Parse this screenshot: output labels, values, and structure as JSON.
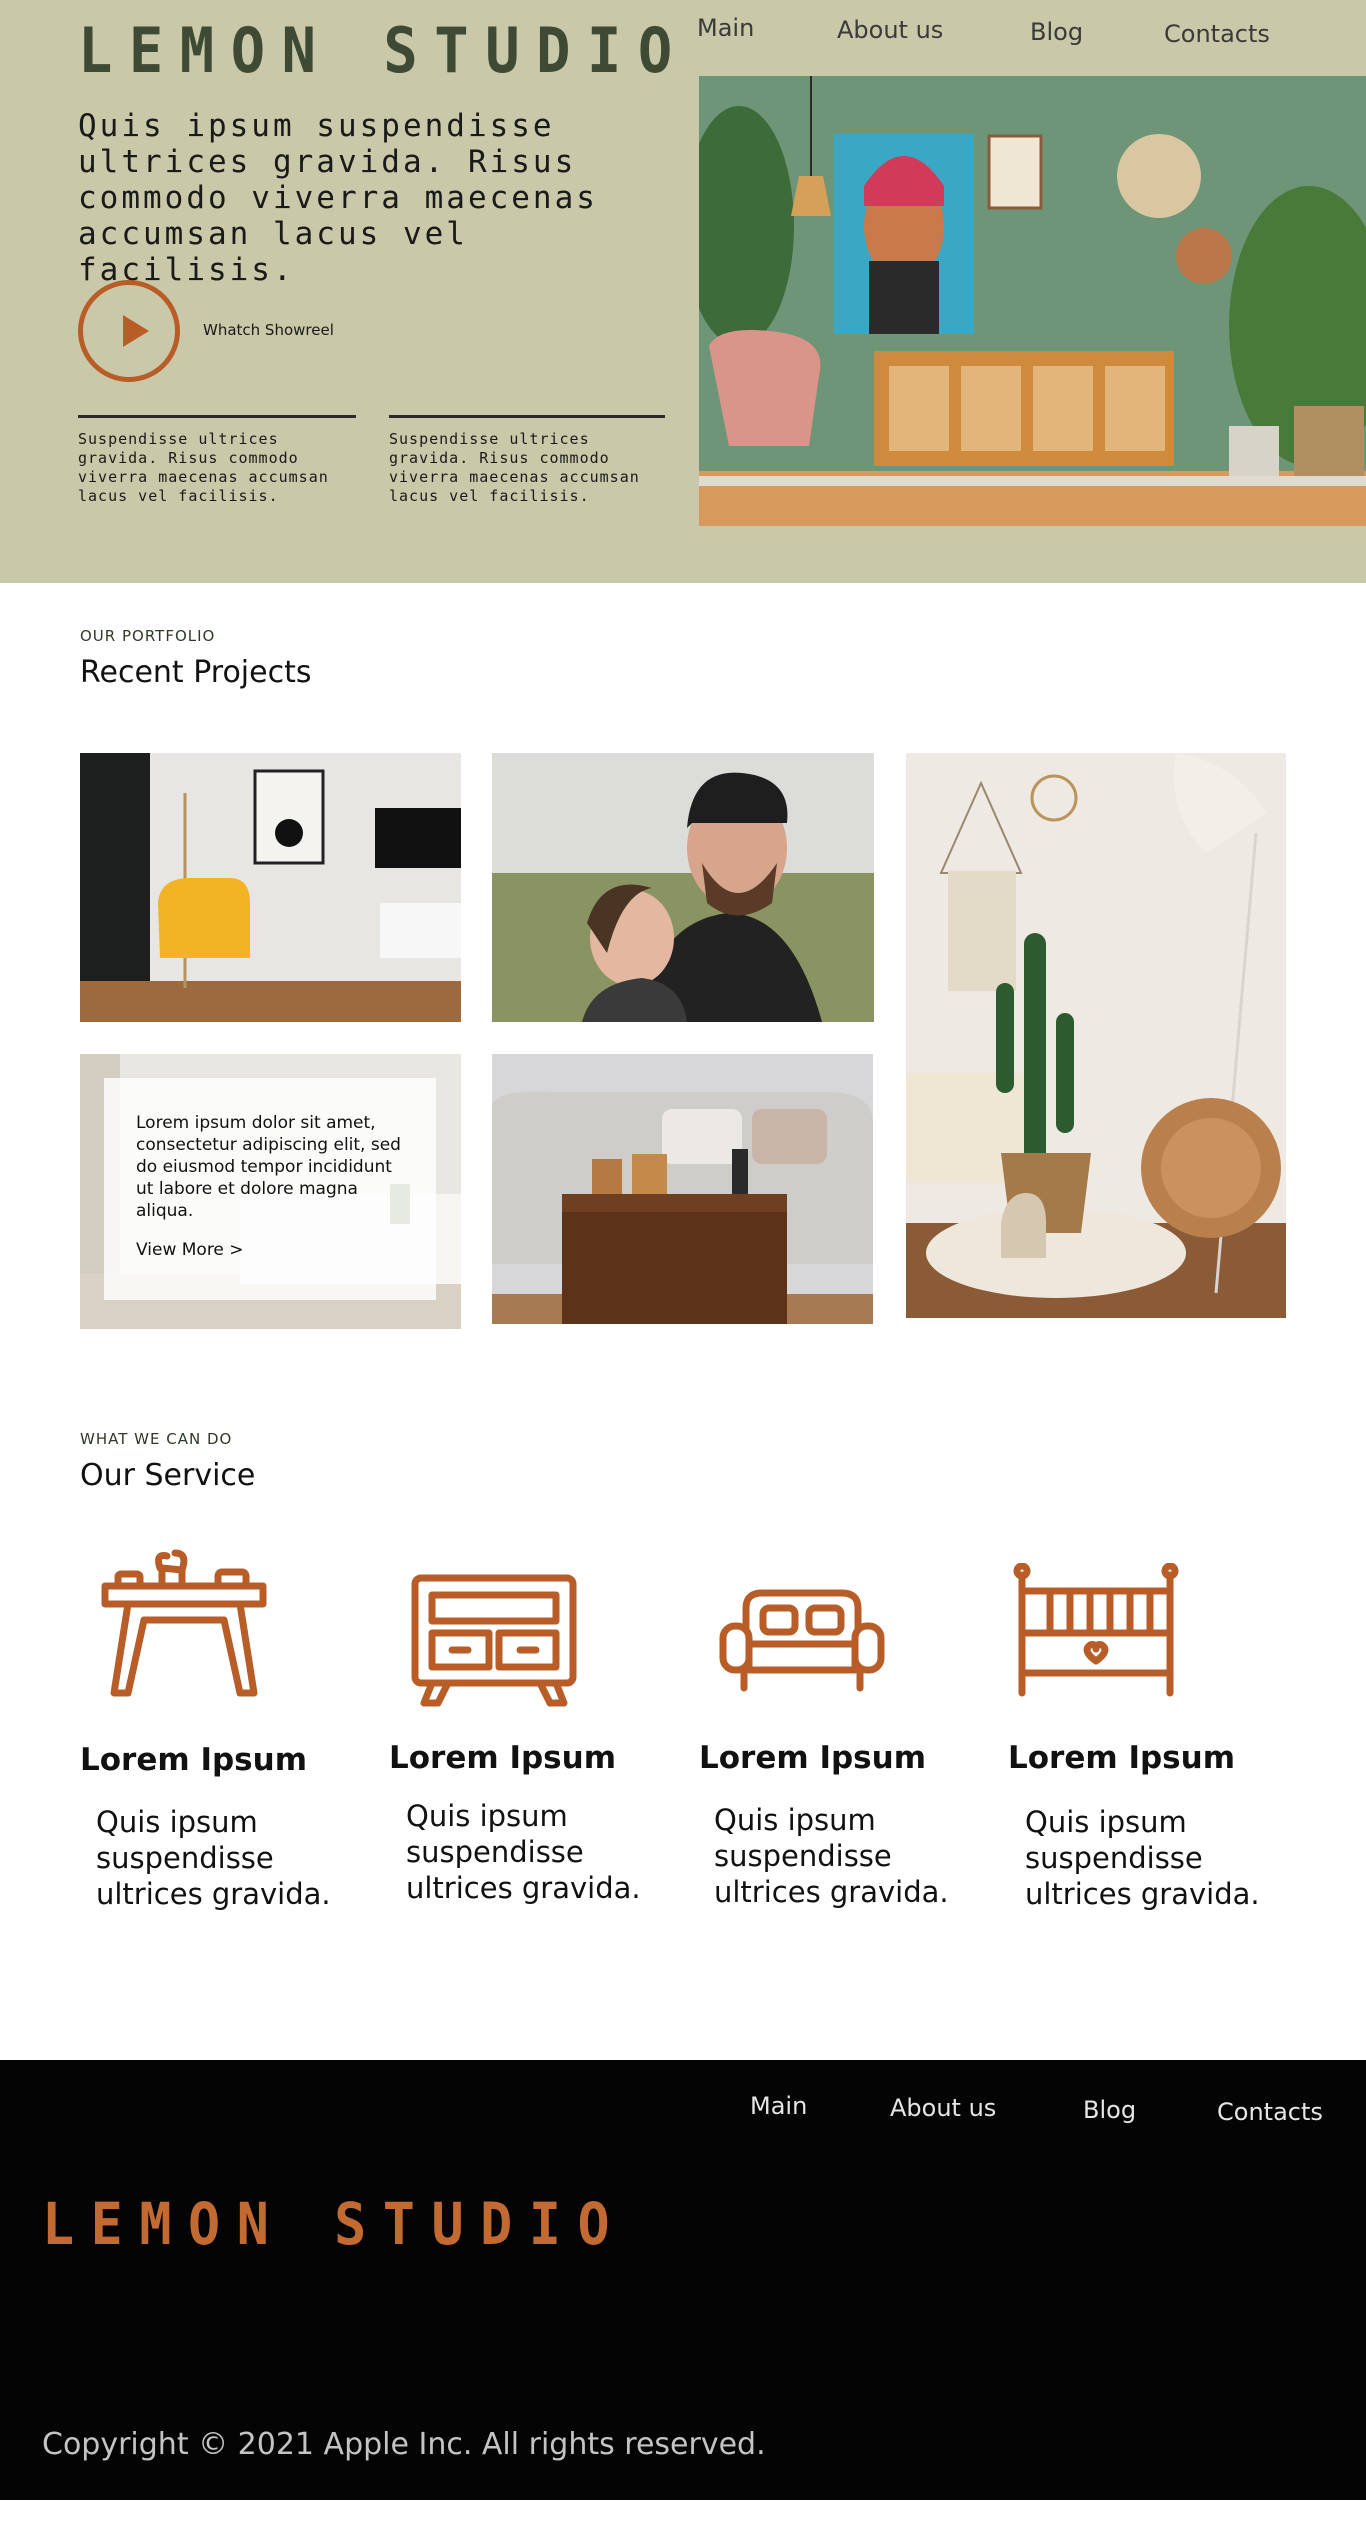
{
  "brand": {
    "name": "LEMON STUDIO",
    "accent": "#b85d27",
    "hero_bg": "#c9c8a8",
    "logo_color": "#3e4a33"
  },
  "nav": {
    "items": [
      "Main",
      "About us",
      "Blog",
      "Contacts"
    ]
  },
  "hero": {
    "headline": "Quis ipsum suspendisse ultrices gravida. Risus commodo viverra maecenas accumsan lacus vel facilisis.",
    "showreel_label": "Whatch Showreel",
    "features": [
      "Suspendisse ultrices gravida. Risus commodo viverra maecenas accumsan lacus vel facilisis.",
      "Suspendisse ultrices gravida. Risus commodo viverra maecenas accumsan lacus vel facilisis."
    ],
    "image": "living-room-photo"
  },
  "portfolio": {
    "eyebrow": "OUR PORTFOLIO",
    "title": "Recent Projects",
    "projects": [
      {
        "name": "yellow-armchair-room-photo"
      },
      {
        "name": "father-daughter-photo"
      },
      {
        "name": "boho-cactus-room-photo"
      },
      {
        "name": "white-living-room-photo"
      },
      {
        "name": "sofa-coffee-table-photo"
      }
    ],
    "overlay_text": "Lorem ipsum dolor sit amet, consectetur adipiscing elit, sed do eiusmod tempor incididunt ut labore et dolore magna aliqua.",
    "view_more": "View More   >"
  },
  "services": {
    "eyebrow": "WHAT WE CAN DO",
    "title": "Our Service",
    "items": [
      {
        "icon": "table-icon",
        "title": "Lorem Ipsum",
        "text": "Quis ipsum suspendisse ultrices gravida."
      },
      {
        "icon": "dresser-icon",
        "title": "Lorem Ipsum",
        "text": "Quis ipsum suspendisse ultrices gravida."
      },
      {
        "icon": "sofa-icon",
        "title": "Lorem Ipsum",
        "text": "Quis ipsum suspendisse ultrices gravida."
      },
      {
        "icon": "crib-icon",
        "title": "Lorem Ipsum",
        "text": "Quis ipsum suspendisse ultrices gravida."
      }
    ]
  },
  "footer": {
    "logo": "LEMON STUDIO",
    "logo_color": "#c26a32",
    "copyright": "Copyright © 2021 Apple Inc. All rights reserved."
  }
}
